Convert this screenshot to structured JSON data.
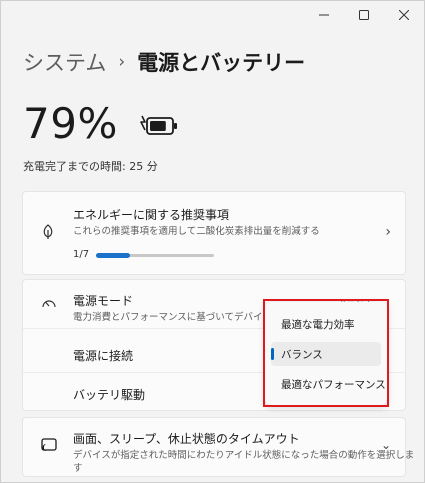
{
  "window": {
    "caption_buttons": [
      "minimize",
      "maximize",
      "close"
    ]
  },
  "breadcrumb": {
    "parent": "システム",
    "separator": "›",
    "current": "電源とバッテリー"
  },
  "battery": {
    "percent": "79%",
    "level": 0.79,
    "remaining": "充電完了までの時間: 25 分"
  },
  "energy_card": {
    "title": "エネルギーに関する推奨事項",
    "subtitle": "これらの推奨事項を適用して二酸化炭素排出量を削減する",
    "progress_label": "1/7",
    "progress_fraction": 0.2857,
    "icon": "leaf-icon"
  },
  "power_card": {
    "title": "電源モード",
    "subtitle": "電力消費とパフォーマンスに基づいてデバイスを最適化します",
    "partial_value": "バランス",
    "plugged_label": "電源に接続",
    "battery_label": "バッテリ駆動",
    "icon": "gauge-icon"
  },
  "dropdown": {
    "items": [
      {
        "label": "最適な電力効率",
        "selected": false
      },
      {
        "label": "バランス",
        "selected": true
      },
      {
        "label": "最適なパフォーマンス",
        "selected": false
      }
    ]
  },
  "timeout_card": {
    "title": "画面、スリープ、休止状態のタイムアウト",
    "subtitle": "デバイスが指定された時間にわたりアイドル状態になった場合の動作を選択しま",
    "subtitle_cont": "す",
    "icon": "screen-sleep-icon"
  },
  "colors": {
    "accent": "#0067c0",
    "progress": "#1a73c8",
    "highlight": "#e0191c"
  }
}
